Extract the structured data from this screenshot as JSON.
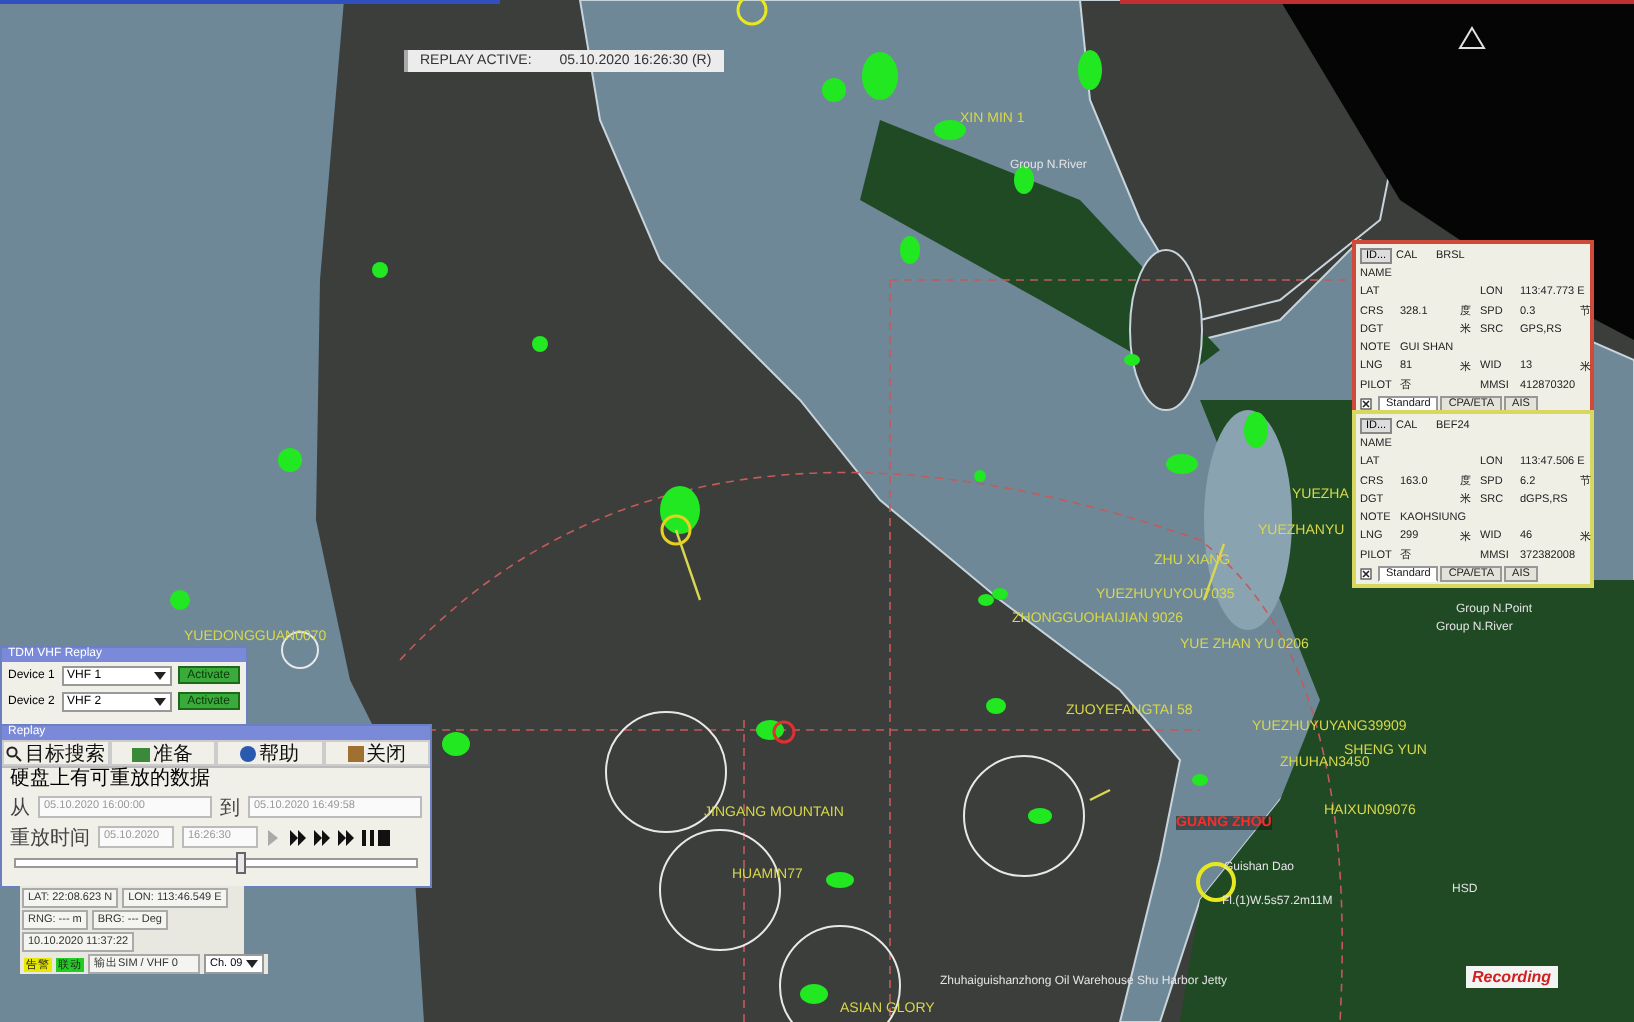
{
  "replay_banner": {
    "label": "REPLAY ACTIVE:",
    "time": "05.10.2020 16:26:30 (R)"
  },
  "vessel_labels": [
    {
      "text": "XIN MIN 1",
      "alarm": false
    },
    {
      "text": "YUEZHUYUYOU7035",
      "alarm": false
    },
    {
      "text": "ZHONGGUOHAIJIAN 9026",
      "alarm": false
    },
    {
      "text": "ZHU XIANG",
      "alarm": false
    },
    {
      "text": "YUE ZHAN YU 0206",
      "alarm": false
    },
    {
      "text": "ZUOYEFANGTAI 58",
      "alarm": false
    },
    {
      "text": "YUEZHUYUYANG39909",
      "alarm": false
    },
    {
      "text": "SHENG YUN",
      "alarm": false
    },
    {
      "text": "ZHUHAN3450",
      "alarm": false
    },
    {
      "text": "HAIXUN09076",
      "alarm": false
    },
    {
      "text": "GUANG ZHOU",
      "alarm": true
    },
    {
      "text": "JINGANG MOUNTAIN",
      "alarm": false
    },
    {
      "text": "HUAMIN77",
      "alarm": false
    },
    {
      "text": "ASIAN GLORY",
      "alarm": false
    },
    {
      "text": "YUEZHA",
      "alarm": false
    },
    {
      "text": "YUEZHANYU",
      "alarm": false
    },
    {
      "text": "YUEDONGGUAN0070",
      "alarm": false
    }
  ],
  "chart_labels": [
    "Group N.River",
    "Guishan Dao",
    "Fl.(1)W.5s57.2m11M",
    "HSD",
    "Zhuhaiguishanzhong Oil Warehouse Shu Harbor Jetty",
    "Group N.Point",
    "Group N.River"
  ],
  "recording": "Recording",
  "vhf_replay": {
    "title": "TDM VHF Replay",
    "devices": [
      {
        "label": "Device 1",
        "value": "VHF 1",
        "button": "Activate"
      },
      {
        "label": "Device 2",
        "value": "VHF 2",
        "button": "Activate"
      }
    ]
  },
  "replay": {
    "title": "Replay",
    "toolbar": [
      "目标搜索",
      "准备",
      "帮助",
      "关闭"
    ],
    "heading": "硬盘上有可重放的数据",
    "from_label": "从",
    "from": "05.10.2020 16:00:00",
    "to_label": "到",
    "to": "05.10.2020 16:49:58",
    "time_label": "重放时间",
    "date": "05.10.2020",
    "time": "16:26:30",
    "slider": {
      "level": 0.56
    }
  },
  "status": {
    "lat": "LAT: 22:08.623 N",
    "lon": "LON: 113:46.549 E",
    "rng": "RNG: --- m",
    "brg": "BRG: --- Deg",
    "datetime": "10.10.2020 11:37:22",
    "badges": [
      {
        "text": "告警",
        "color": "#e8e800"
      },
      {
        "text": "联动",
        "color": "#22cc22"
      }
    ],
    "output": "输出SIM / VHF 0",
    "channel": "Ch. 09"
  },
  "info_cards": [
    {
      "color": "#d04a3a",
      "id_button": "ID...",
      "cal_label": "CAL",
      "cal": "BRSL",
      "rows": [
        {
          "label": "NAME"
        },
        {
          "label": "LAT",
          "label2": "LON",
          "value2": "113:47.773 E"
        },
        {
          "label": "CRS",
          "value": "328.1",
          "unit": "度",
          "label2": "SPD",
          "value2": "0.3",
          "unit2": "节"
        },
        {
          "label": "DGT",
          "unit": "米",
          "label2": "SRC",
          "value2": "GPS,RS"
        },
        {
          "label": "NOTE",
          "value": "GUI SHAN"
        },
        {
          "label": "LNG",
          "value": "81",
          "unit": "米",
          "label2": "WID",
          "value2": "13",
          "unit2": "米"
        },
        {
          "label": "PILOT",
          "value": "否",
          "label2": "MMSI",
          "value2": "412870320"
        }
      ],
      "tabs": [
        {
          "label": "Standard",
          "selected": true
        },
        {
          "label": "CPA/ETA",
          "selected": false
        },
        {
          "label": "AIS",
          "selected": false
        }
      ]
    },
    {
      "color": "#d8d860",
      "id_button": "ID...",
      "cal_label": "CAL",
      "cal": "BEF24",
      "rows": [
        {
          "label": "NAME"
        },
        {
          "label": "LAT",
          "label2": "LON",
          "value2": "113:47.506 E"
        },
        {
          "label": "CRS",
          "value": "163.0",
          "unit": "度",
          "label2": "SPD",
          "value2": "6.2",
          "unit2": "节"
        },
        {
          "label": "DGT",
          "unit": "米",
          "label2": "SRC",
          "value2": "dGPS,RS"
        },
        {
          "label": "NOTE",
          "value": "KAOHSIUNG"
        },
        {
          "label": "LNG",
          "value": "299",
          "unit": "米",
          "label2": "WID",
          "value2": "46",
          "unit2": "米"
        },
        {
          "label": "PILOT",
          "value": "否",
          "label2": "MMSI",
          "value2": "372382008"
        }
      ],
      "tabs": [
        {
          "label": "Standard",
          "selected": true
        },
        {
          "label": "CPA/ETA",
          "selected": false
        },
        {
          "label": "AIS",
          "selected": false
        }
      ]
    }
  ]
}
